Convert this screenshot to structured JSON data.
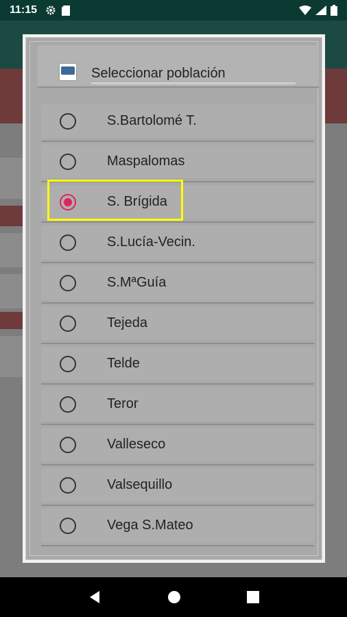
{
  "status_bar": {
    "time": "11:15",
    "icons_left": [
      "gear-icon",
      "sd-card-icon"
    ],
    "icons_right": [
      "wifi-icon",
      "signal-icon",
      "battery-icon"
    ]
  },
  "dialog": {
    "title": "Seleccionar población",
    "options": [
      {
        "label": "S.Bartolomé T.",
        "selected": false
      },
      {
        "label": "Maspalomas",
        "selected": false
      },
      {
        "label": "S. Brígida",
        "selected": true
      },
      {
        "label": "S.Lucía-Vecin.",
        "selected": false
      },
      {
        "label": "S.MªGuía",
        "selected": false
      },
      {
        "label": "Tejeda",
        "selected": false
      },
      {
        "label": "Telde",
        "selected": false
      },
      {
        "label": "Teror",
        "selected": false
      },
      {
        "label": "Valleseco",
        "selected": false
      },
      {
        "label": "Valsequillo",
        "selected": false
      },
      {
        "label": "Vega S.Mateo",
        "selected": false
      }
    ]
  },
  "colors": {
    "radio_selected": "#e0245e",
    "highlight": "#ffff00",
    "status_bar": "#0b3a33"
  },
  "nav_bar": {
    "buttons": [
      "back-icon",
      "home-icon",
      "recents-icon"
    ]
  }
}
